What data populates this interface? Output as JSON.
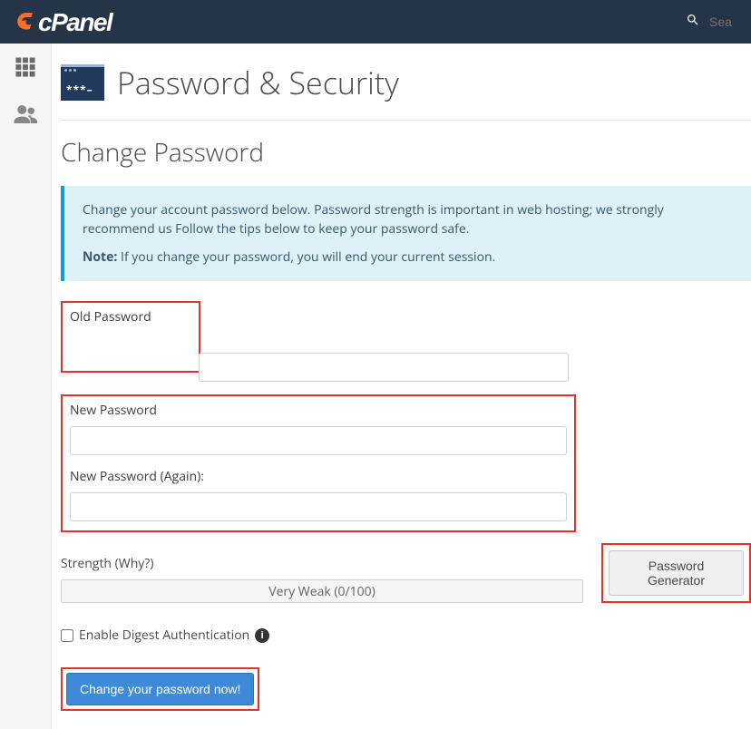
{
  "header": {
    "logo_text": "cPanel",
    "search_placeholder": "Sea"
  },
  "page": {
    "title": "Password & Security",
    "icon_stars": "***–"
  },
  "section": {
    "title": "Change Password",
    "info_line1": "Change your account password below. Password strength is important in web hosting; we strongly recommend us Follow the tips below to keep your password safe.",
    "note_label": "Note:",
    "note_text": " If you change your password, you will end your current session."
  },
  "fields": {
    "old_password_label": "Old Password",
    "new_password_label": "New Password",
    "new_password_again_label": "New Password (Again):"
  },
  "strength": {
    "label": "Strength (Why?)",
    "value": "Very Weak (0/100)",
    "generator_button": "Password Generator"
  },
  "digest": {
    "label": "Enable Digest Authentication"
  },
  "actions": {
    "submit": "Change your password now!"
  }
}
